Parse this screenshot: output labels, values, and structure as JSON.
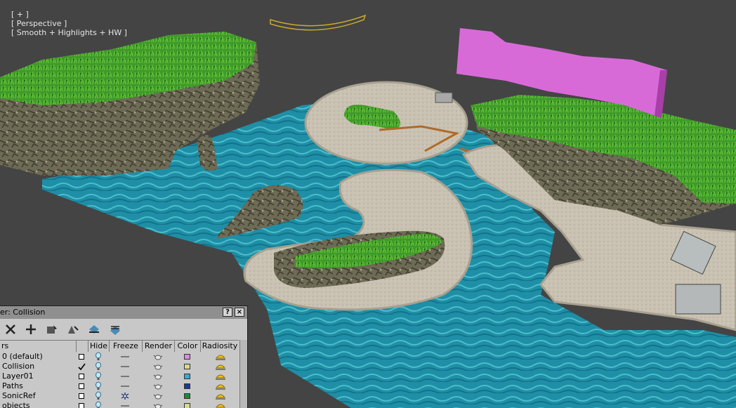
{
  "viewport": {
    "label_plus": "[ + ]",
    "label_view": "[ Perspective ]",
    "label_shading": "[ Smooth + Highlights + HW ]"
  },
  "layer_manager": {
    "title": "er: Collision",
    "help_label": "?",
    "close_label": "×",
    "toolbar": [
      "delete-icon",
      "add-icon",
      "select-icon",
      "highlight-icon",
      "hide-all-icon",
      "freeze-all-icon"
    ],
    "columns": {
      "name": "rs",
      "hide": "Hide",
      "freeze": "Freeze",
      "render": "Render",
      "color": "Color",
      "radiosity": "Radiosity"
    },
    "layers": [
      {
        "name": "0 (default)",
        "current": false,
        "color": "#d98ae0"
      },
      {
        "name": "Collision",
        "current": true,
        "color": "#d8d890"
      },
      {
        "name": "Layer01",
        "current": false,
        "color": "#3aa8d8"
      },
      {
        "name": "Paths",
        "current": false,
        "color": "#1f3a8a"
      },
      {
        "name": "SonicRef",
        "current": false,
        "color": "#1f8a3a"
      },
      {
        "name": "objects",
        "current": false,
        "color": "#d8d890"
      }
    ]
  }
}
